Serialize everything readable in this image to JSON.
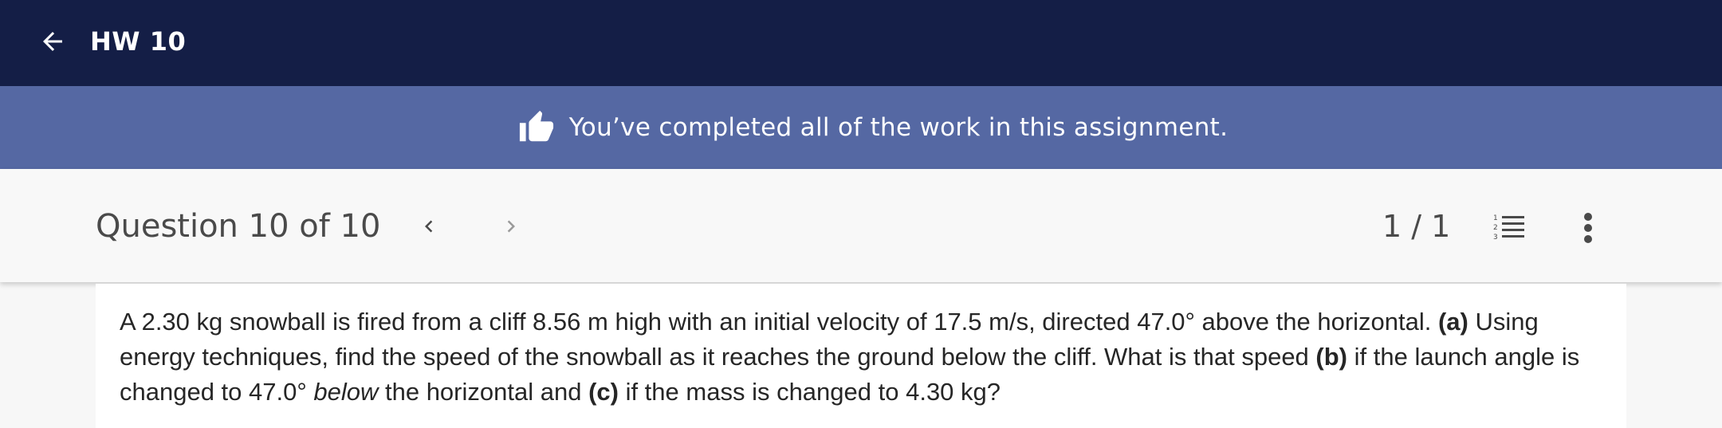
{
  "header": {
    "title": "HW 10",
    "back_icon": "arrow-left-icon"
  },
  "banner": {
    "icon": "thumbs-up-icon",
    "message": "You’ve completed all of the work in this assignment."
  },
  "question_bar": {
    "title": "Question 10 of 10",
    "prev_icon": "chevron-left-icon",
    "next_icon": "chevron-right-icon",
    "page_count": "1 / 1",
    "list_icon": "numbered-list-icon",
    "more_icon": "more-vertical-icon"
  },
  "question": {
    "part1": "A 2.30 kg snowball is fired from a cliff 8.56 m high with an initial velocity of 17.5 m/s, directed 47.0° above the horizontal. ",
    "label_a": "(a)",
    "part2": " Using energy techniques, find the speed of the snowball as it reaches the ground below the cliff. What is that speed ",
    "label_b": "(b)",
    "part3": " if the launch angle is changed to 47.0° ",
    "below": "below",
    "part4": " the horizontal and ",
    "label_c": "(c)",
    "part5": " if the mass is changed to 4.30 kg?"
  },
  "colors": {
    "topbar": "#141e46",
    "banner": "#5568a3",
    "background": "#f7f7f7"
  }
}
